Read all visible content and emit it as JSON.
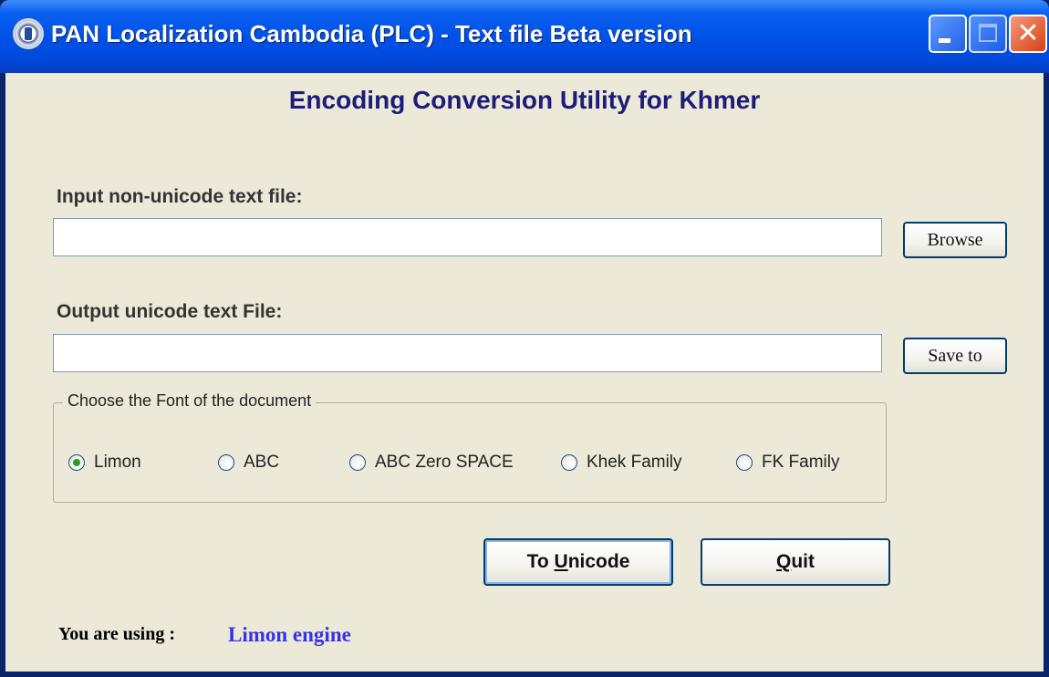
{
  "window": {
    "title": "PAN Localization Cambodia (PLC) - Text file Beta version",
    "icons": {
      "app": "plc-logo-icon",
      "minimize": "minimize-icon",
      "maximize": "maximize-icon",
      "close": "close-icon"
    },
    "close_glyph": "✕"
  },
  "heading": "Encoding Conversion Utility for Khmer",
  "input": {
    "label": "Input non-unicode text file:",
    "value": "",
    "button_label": "Browse"
  },
  "output": {
    "label": "Output unicode text File:",
    "value": "",
    "button_label": "Save to"
  },
  "font_group": {
    "label": "Choose the Font of the document",
    "options": [
      {
        "label": "Limon",
        "checked": true
      },
      {
        "label": "ABC",
        "checked": false
      },
      {
        "label": "ABC Zero SPACE",
        "checked": false
      },
      {
        "label": "Khek Family",
        "checked": false
      },
      {
        "label": "FK Family",
        "checked": false
      }
    ]
  },
  "actions": {
    "to_unicode": {
      "prefix": "To ",
      "mnemonic": "U",
      "rest": "nicode"
    },
    "quit": {
      "prefix": "",
      "mnemonic": "Q",
      "rest": "uit"
    }
  },
  "status": {
    "label": "You are using :",
    "value": "Limon engine"
  },
  "colors": {
    "titlebar": "#0050e6",
    "heading": "#1c1c7a",
    "status_value": "#3434e6",
    "radio_checked": "#21a121",
    "window_bg": "#ece9d8"
  }
}
